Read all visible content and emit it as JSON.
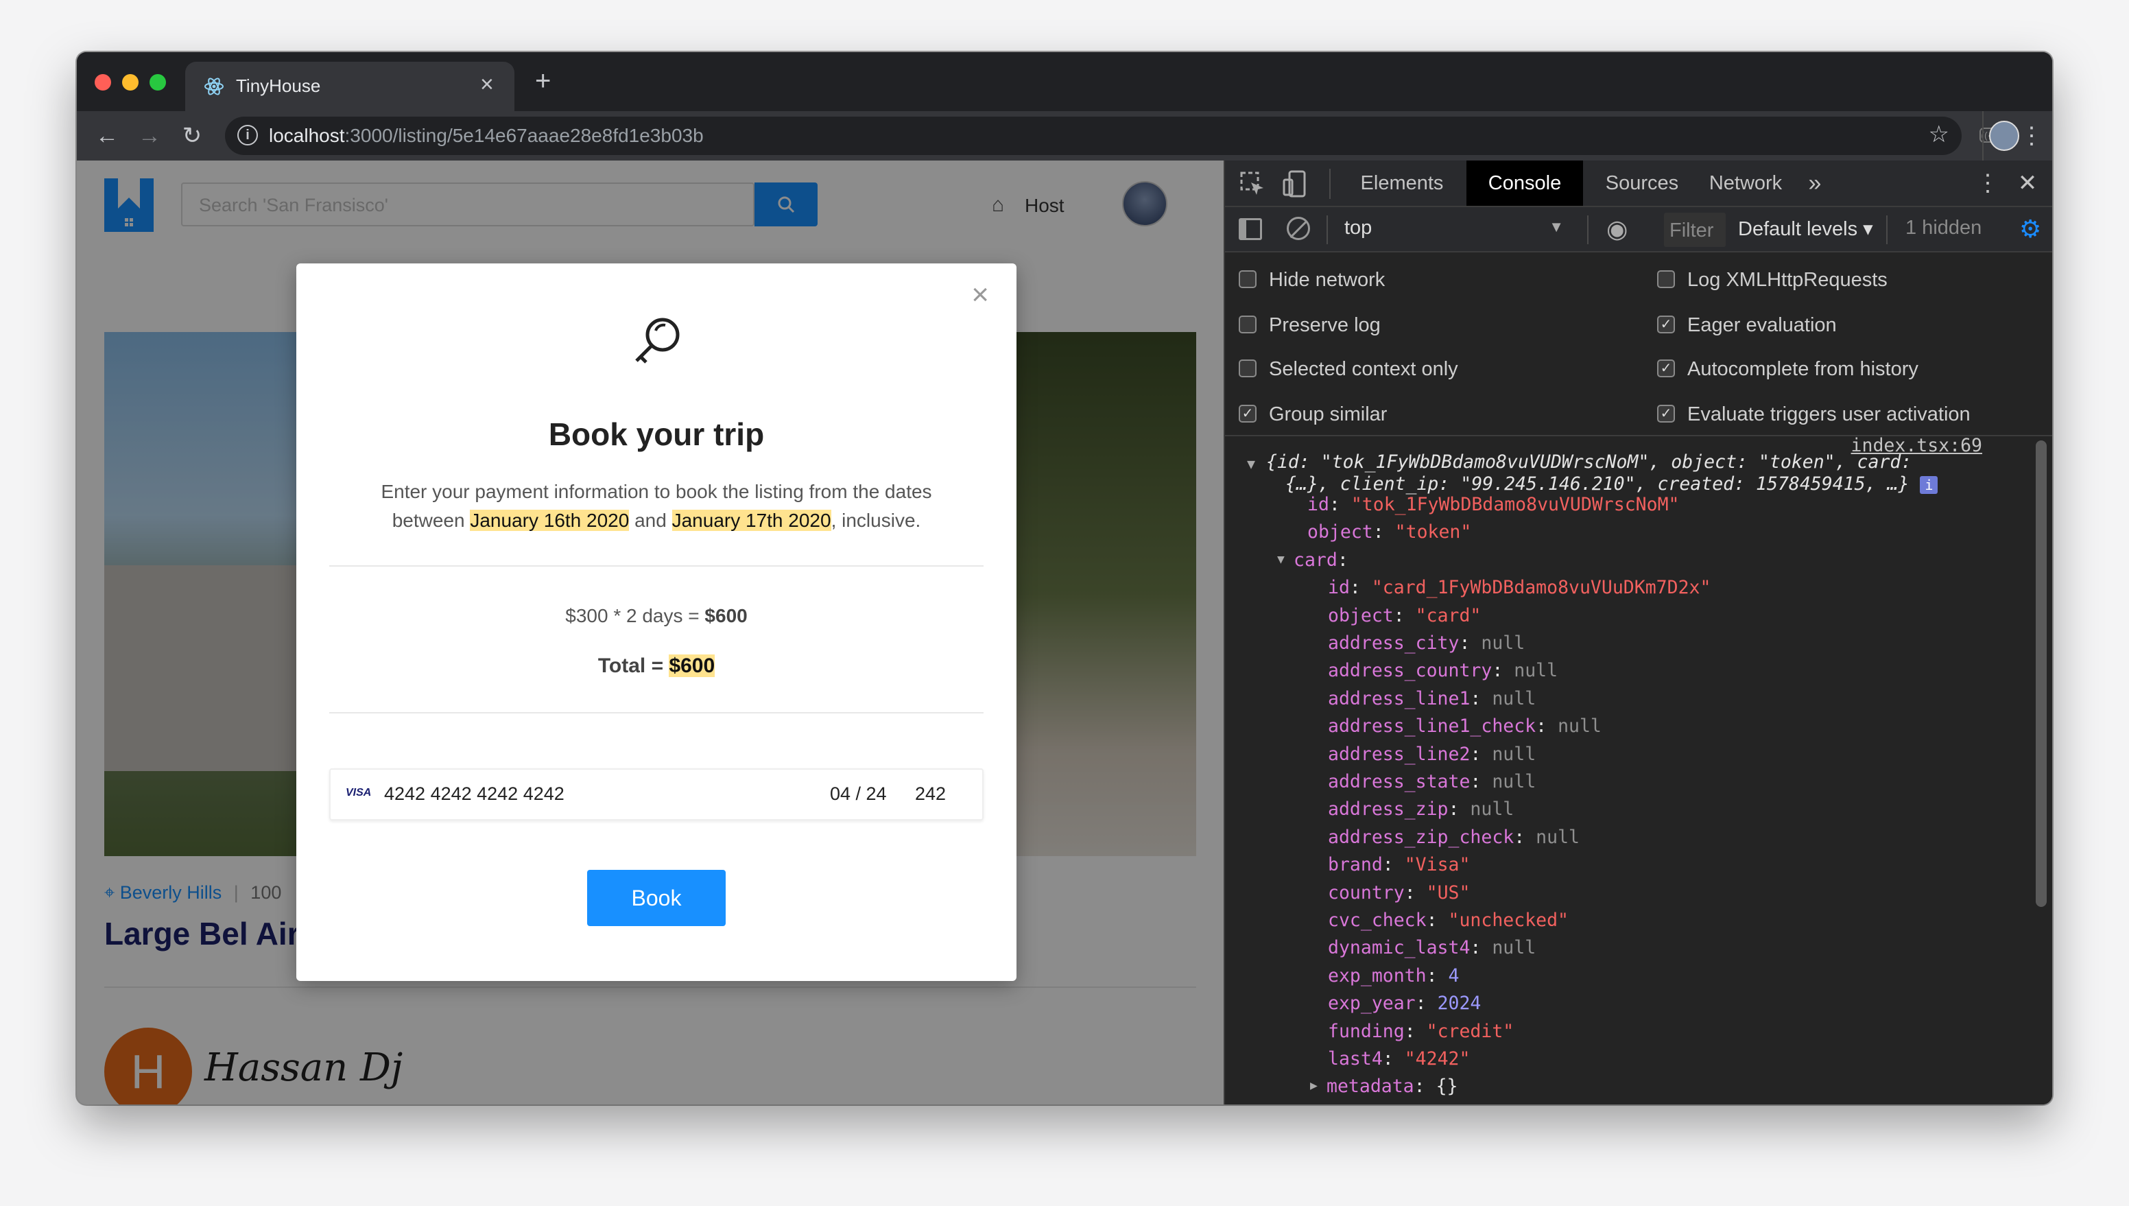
{
  "browser": {
    "tab_title": "TinyHouse",
    "tab_close": "×",
    "new_tab": "+",
    "url_host": "localhost",
    "url_path": ":3000/listing/5e14e67aaae28e8fd1e3b03b"
  },
  "app": {
    "search_placeholder": "Search 'San Fransisco'",
    "host_label": "Host",
    "location": "Beverly Hills",
    "address_partial": "100",
    "listing_title_partial": "Large Bel Air",
    "host_initial": "H",
    "host_name": "Hassan Dj"
  },
  "modal": {
    "close": "×",
    "title": "Book your trip",
    "desc_prefix": "Enter your payment information to book the listing from the dates between",
    "date_start": "January 16th 2020",
    "desc_and": "and",
    "date_end": "January 17th 2020",
    "desc_suffix": ", inclusive.",
    "price_calc_prefix": "$300 * 2 days = ",
    "price_calc_total": "$600",
    "total_label": "Total = ",
    "total_value": "$600",
    "card_brand": "VISA",
    "card_number": "4242 4242 4242 4242",
    "card_exp": "04 / 24",
    "card_cvc": "242",
    "book_button": "Book"
  },
  "devtools": {
    "tabs": [
      "Elements",
      "Console",
      "Sources",
      "Network"
    ],
    "active_tab": "Console",
    "more_tabs": "»",
    "context": "top",
    "filter_placeholder": "Filter",
    "levels": "Default levels ▾",
    "hidden": "1 hidden",
    "options_left": [
      {
        "label": "Hide network",
        "checked": false
      },
      {
        "label": "Preserve log",
        "checked": false
      },
      {
        "label": "Selected context only",
        "checked": false
      },
      {
        "label": "Group similar",
        "checked": true
      }
    ],
    "options_right": [
      {
        "label": "Log XMLHttpRequests",
        "checked": false
      },
      {
        "label": "Eager evaluation",
        "checked": true
      },
      {
        "label": "Autocomplete from history",
        "checked": true
      },
      {
        "label": "Evaluate triggers user activation",
        "checked": true
      }
    ],
    "source_link": "index.tsx:69",
    "summary_line1": "{id: \"tok_1FyWbDBdamo8vuVUDWrscNoM\", object: \"token\", card:",
    "summary_line2": "{…}, client_ip: \"99.245.146.210\", created: 1578459415, …}",
    "object_lines": [
      {
        "indent": 1,
        "key": "id",
        "type": "s",
        "value": "\"tok_1FyWbDBdamo8vuVUDWrscNoM\""
      },
      {
        "indent": 1,
        "key": "object",
        "type": "s",
        "value": "\"token\""
      },
      {
        "indent": 0,
        "key": "card",
        "type": "p",
        "value": "",
        "expanded": true
      },
      {
        "indent": 2,
        "key": "id",
        "type": "s",
        "value": "\"card_1FyWbDBdamo8vuVUuDKm7D2x\""
      },
      {
        "indent": 2,
        "key": "object",
        "type": "s",
        "value": "\"card\""
      },
      {
        "indent": 2,
        "key": "address_city",
        "type": "nul",
        "value": "null"
      },
      {
        "indent": 2,
        "key": "address_country",
        "type": "nul",
        "value": "null"
      },
      {
        "indent": 2,
        "key": "address_line1",
        "type": "nul",
        "value": "null"
      },
      {
        "indent": 2,
        "key": "address_line1_check",
        "type": "nul",
        "value": "null"
      },
      {
        "indent": 2,
        "key": "address_line2",
        "type": "nul",
        "value": "null"
      },
      {
        "indent": 2,
        "key": "address_state",
        "type": "nul",
        "value": "null"
      },
      {
        "indent": 2,
        "key": "address_zip",
        "type": "nul",
        "value": "null"
      },
      {
        "indent": 2,
        "key": "address_zip_check",
        "type": "nul",
        "value": "null"
      },
      {
        "indent": 2,
        "key": "brand",
        "type": "s",
        "value": "\"Visa\""
      },
      {
        "indent": 2,
        "key": "country",
        "type": "s",
        "value": "\"US\""
      },
      {
        "indent": 2,
        "key": "cvc_check",
        "type": "s",
        "value": "\"unchecked\""
      },
      {
        "indent": 2,
        "key": "dynamic_last4",
        "type": "nul",
        "value": "null"
      },
      {
        "indent": 2,
        "key": "exp_month",
        "type": "n",
        "value": "4"
      },
      {
        "indent": 2,
        "key": "exp_year",
        "type": "n",
        "value": "2024"
      },
      {
        "indent": 2,
        "key": "funding",
        "type": "s",
        "value": "\"credit\""
      },
      {
        "indent": 2,
        "key": "last4",
        "type": "s",
        "value": "\"4242\""
      },
      {
        "indent": 1,
        "key": "metadata",
        "type": "p",
        "value": "{}",
        "collapsed": true
      }
    ]
  },
  "colors": {
    "brand_blue": "#1890ff",
    "highlight": "#ffe38f",
    "devtools_bg": "#242424",
    "string": "#f2615f",
    "key": "#d977d9",
    "number": "#9b99ff"
  }
}
